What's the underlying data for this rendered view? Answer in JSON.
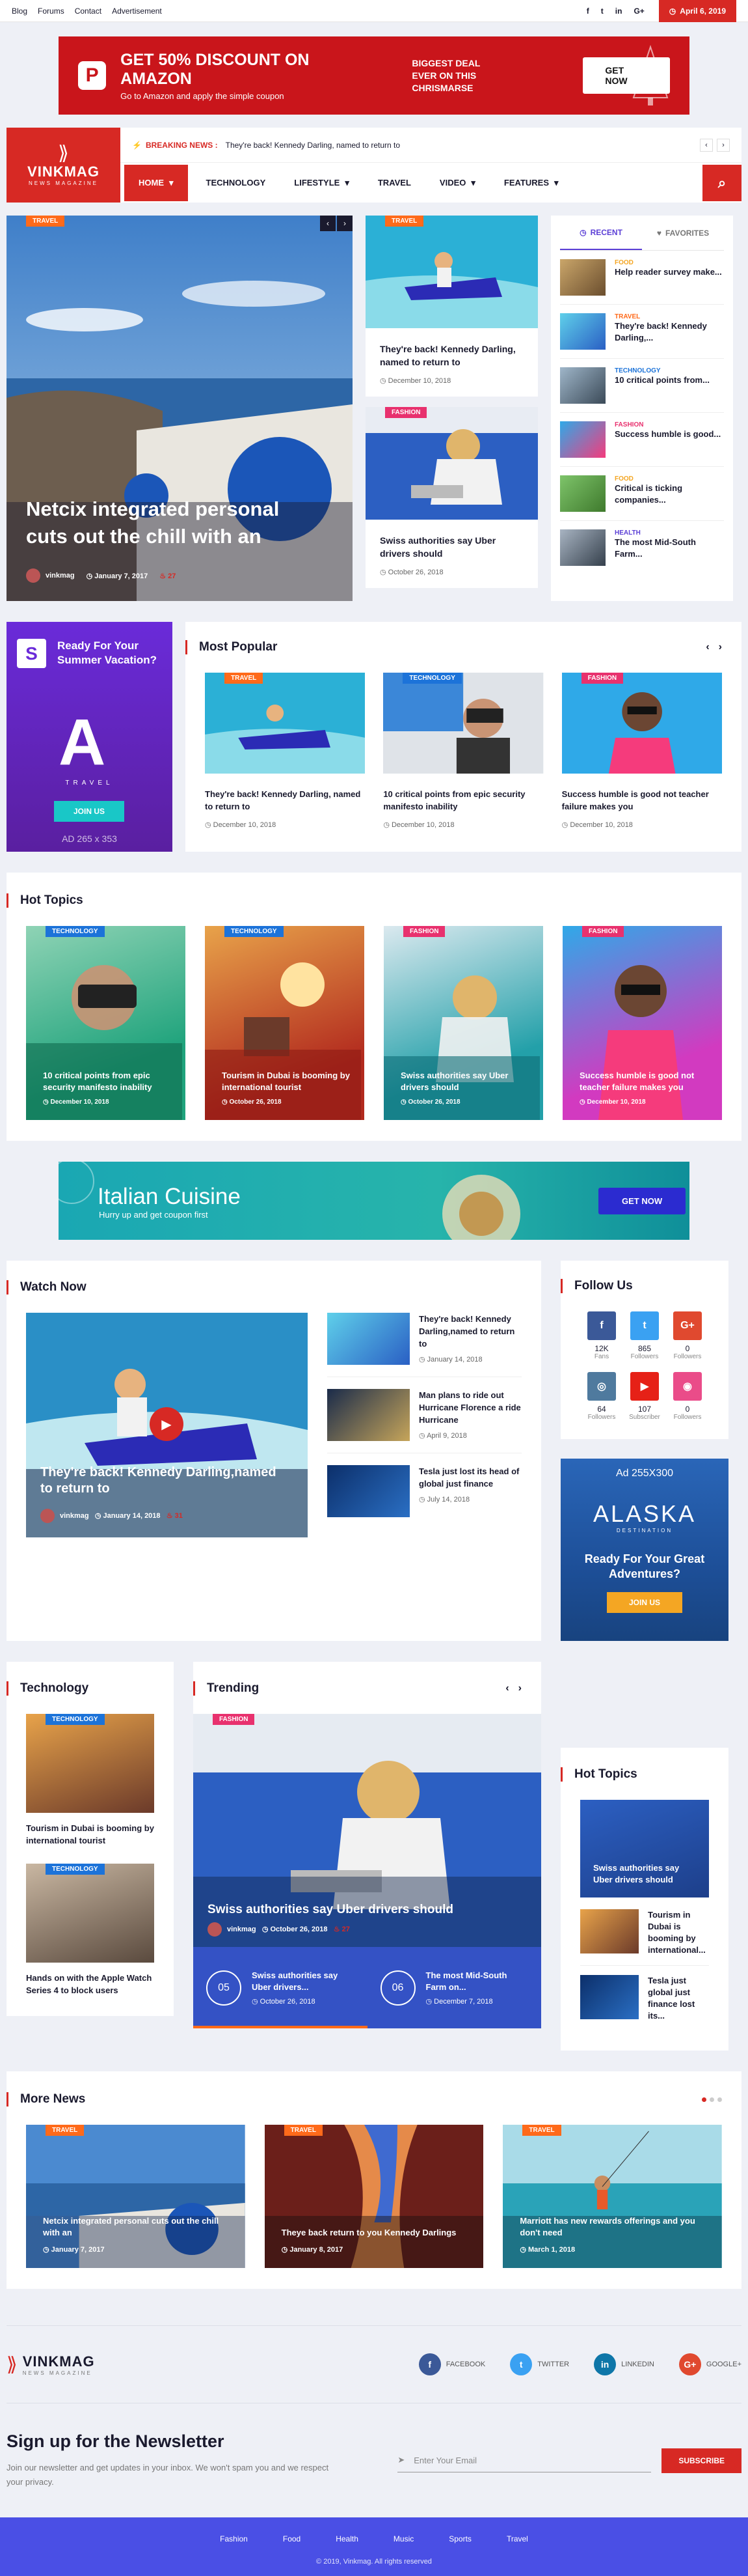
{
  "topbar": {
    "links": [
      "Blog",
      "Forums",
      "Contact",
      "Advertisement"
    ],
    "social_icons": [
      "facebook-icon",
      "twitter-icon",
      "linkedin-icon",
      "google-plus-icon"
    ],
    "social_glyphs": [
      "f",
      "t",
      "in",
      "G+"
    ],
    "date": "April 6, 2019"
  },
  "ad_top": {
    "headline": "GET 50% DISCOUNT ON AMAZON",
    "sub": "Go to Amazon and apply the simple coupon",
    "mid1": "BIGGEST DEAL",
    "mid2": "EVER ON THIS CHRISMARSE",
    "button": "GET NOW",
    "logo_letter": "P"
  },
  "logo": {
    "name": "VINKMAG",
    "sub": "NEWS MAGAZINE"
  },
  "breaking": {
    "label": "BREAKING NEWS :",
    "text": "They're back! Kennedy Darling, named to return to"
  },
  "nav": {
    "items": [
      "HOME",
      "TECHNOLOGY",
      "LIFESTYLE",
      "TRAVEL",
      "VIDEO",
      "FEATURES"
    ]
  },
  "hero": {
    "main": {
      "tag": "TRAVEL",
      "title": "Netcix integrated personal cuts out the chill with an",
      "author": "vinkmag",
      "date": "January 7, 2017",
      "likes": "27"
    },
    "col": [
      {
        "tag": "TRAVEL",
        "title": "They're back! Kennedy Darling, named to return to",
        "date": "December 10, 2018"
      },
      {
        "tag": "FASHION",
        "title": "Swiss authorities say Uber drivers should",
        "date": "October 26, 2018"
      }
    ]
  },
  "side_tabs": {
    "tabs": [
      "RECENT",
      "FAVORITES"
    ],
    "items": [
      {
        "cat": "FOOD",
        "title": "Help reader survey make..."
      },
      {
        "cat": "TRAVEL",
        "title": "They're back! Kennedy Darling,..."
      },
      {
        "cat": "TECHNOLOGY",
        "title": "10 critical points from..."
      },
      {
        "cat": "FASHION",
        "title": "Success humble is good..."
      },
      {
        "cat": "FOOD",
        "title": "Critical is ticking companies..."
      },
      {
        "cat": "HEALTH",
        "title": "The most Mid-South Farm..."
      }
    ]
  },
  "ad_side": {
    "letter": "S",
    "question": "Ready For Your Summer Vacation?",
    "big": "A",
    "brand": "TRAVEL",
    "button": "JOIN US",
    "size": "AD 265 x 353"
  },
  "popular": {
    "title": "Most Popular",
    "items": [
      {
        "tag": "TRAVEL",
        "title": "They're back! Kennedy Darling, named to return to",
        "date": "December 10, 2018"
      },
      {
        "tag": "TECHNOLOGY",
        "title": "10 critical points from epic security manifesto inability",
        "date": "December 10, 2018"
      },
      {
        "tag": "FASHION",
        "title": "Success humble is good not teacher failure makes you",
        "date": "December 10, 2018"
      }
    ]
  },
  "hot_topics": {
    "title": "Hot Topics",
    "items": [
      {
        "tag": "TECHNOLOGY",
        "title": "10 critical points from epic security manifesto inability",
        "date": "December 10, 2018"
      },
      {
        "tag": "TECHNOLOGY",
        "title": "Tourism in Dubai is booming by international tourist",
        "date": "October 26, 2018"
      },
      {
        "tag": "FASHION",
        "title": "Swiss authorities say Uber drivers should",
        "date": "October 26, 2018"
      },
      {
        "tag": "FASHION",
        "title": "Success humble is good not teacher failure makes you",
        "date": "December 10, 2018"
      }
    ]
  },
  "cuisine": {
    "title": "Italian Cuisine",
    "sub": "Hurry up and get coupon first",
    "button": "GET NOW"
  },
  "watch": {
    "title": "Watch Now",
    "video": {
      "title": "They're back! Kennedy Darling,named to return to",
      "author": "vinkmag",
      "date": "January 14, 2018",
      "likes": "31"
    },
    "items": [
      {
        "title": "They're back! Kennedy Darling,named to return to",
        "date": "January 14, 2018"
      },
      {
        "title": "Man plans to ride out Hurricane Florence a ride Hurricane",
        "date": "April 9, 2018"
      },
      {
        "title": "Tesla just lost its head of global just finance",
        "date": "July 14, 2018"
      }
    ]
  },
  "follow": {
    "title": "Follow Us",
    "items": [
      {
        "glyph": "f",
        "count": "12K",
        "label": "Fans"
      },
      {
        "glyph": "t",
        "count": "865",
        "label": "Followers"
      },
      {
        "glyph": "G+",
        "count": "0",
        "label": "Followers"
      },
      {
        "glyph": "◎",
        "count": "64",
        "label": "Followers"
      },
      {
        "glyph": "▶",
        "count": "107",
        "label": "Subscriber"
      },
      {
        "glyph": "◉",
        "count": "0",
        "label": "Followers"
      }
    ]
  },
  "alaska": {
    "size": "Ad 255X300",
    "name": "ALASKA",
    "desc": "DESTINATION",
    "ready": "Ready For Your Great Adventures?",
    "button": "JOIN US"
  },
  "technology": {
    "title": "Technology",
    "items": [
      {
        "tag": "TECHNOLOGY",
        "title": "Tourism in Dubai is booming by international tourist"
      },
      {
        "tag": "TECHNOLOGY",
        "title": "Hands on with the Apple Watch Series 4 to block users"
      }
    ]
  },
  "trending": {
    "title": "Trending",
    "main": {
      "tag": "FASHION",
      "title": "Swiss authorities say Uber drivers should",
      "author": "vinkmag",
      "date": "October 26, 2018",
      "likes": "27"
    },
    "list": [
      {
        "num": "05",
        "title": "Swiss authorities say Uber drivers...",
        "date": "October 26, 2018"
      },
      {
        "num": "06",
        "title": "The most Mid-South Farm on...",
        "date": "December 7, 2018"
      }
    ]
  },
  "hot2": {
    "title": "Hot Topics",
    "big": "Swiss authorities say Uber drivers should",
    "items": [
      {
        "title": "Tourism in Dubai is booming by international..."
      },
      {
        "title": "Tesla just global just finance lost its..."
      }
    ]
  },
  "more_news": {
    "title": "More News",
    "items": [
      {
        "tag": "TRAVEL",
        "title": "Netcix integrated personal cuts out the chill with an",
        "date": "January 7, 2017"
      },
      {
        "tag": "TRAVEL",
        "title": "Theye back return to you Kennedy Darlings",
        "date": "January 8, 2017"
      },
      {
        "tag": "TRAVEL",
        "title": "Marriott has new rewards offerings and you don't need",
        "date": "March 1, 2018"
      }
    ]
  },
  "footer": {
    "social": [
      {
        "glyph": "f",
        "label": "FACEBOOK"
      },
      {
        "glyph": "t",
        "label": "TWITTER"
      },
      {
        "glyph": "in",
        "label": "LINKEDIN"
      },
      {
        "glyph": "G+",
        "label": "GOOGLE+"
      }
    ],
    "newsletter_title": "Sign up for the Newsletter",
    "newsletter_text": "Join our newsletter and get updates in your inbox. We won't spam you and we respect your privacy.",
    "email_placeholder": "Enter Your Email",
    "subscribe": "SUBSCRIBE",
    "links": [
      "Fashion",
      "Food",
      "Health",
      "Music",
      "Sports",
      "Travel"
    ],
    "copyright": "© 2019, Vinkmag. All rights reserved"
  },
  "colors": {
    "accent": "#d72924",
    "travel": "#ff6a1a",
    "fashion": "#e8316e",
    "technology": "#1c73d9",
    "recent": "#5b3fd6"
  }
}
